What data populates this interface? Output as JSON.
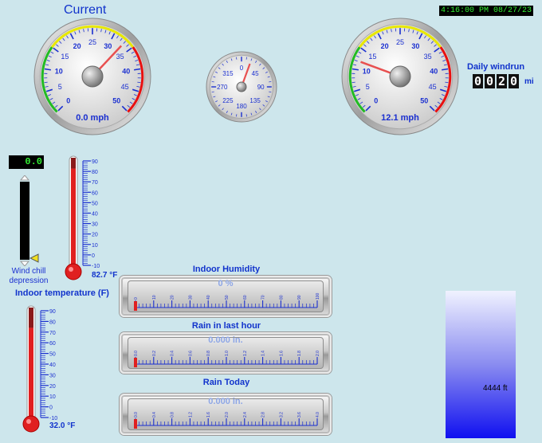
{
  "header": {
    "title": "Current",
    "timestamp": "4:16:00 PM 08/27/23"
  },
  "wind_gauge": {
    "value_label": "0.0 mph",
    "ticks": [
      "0",
      "5",
      "10",
      "15",
      "20",
      "25",
      "30",
      "35",
      "40",
      "45",
      "50"
    ],
    "min": 0,
    "max": 50,
    "needle": 33
  },
  "direction_gauge": {
    "ticks": [
      "315",
      "0",
      "45",
      "90",
      "135",
      "180",
      "225",
      "270"
    ],
    "needle_deg": 20
  },
  "gust_gauge": {
    "value_label": "12.1 mph",
    "ticks": [
      "0",
      "5",
      "10",
      "15",
      "20",
      "25",
      "30",
      "35",
      "40",
      "45",
      "50"
    ],
    "min": 0,
    "max": 50,
    "needle": 12.1
  },
  "windrun": {
    "label": "Daily windrun",
    "digits": [
      "0",
      "0",
      "2",
      "0"
    ],
    "unit": "mi"
  },
  "wind_chill": {
    "display": "0.0",
    "label_line1": "Wind chill",
    "label_line2": "depression",
    "value": 0.0
  },
  "outdoor_thermo": {
    "ticks": [
      "90",
      "80",
      "70",
      "60",
      "50",
      "40",
      "30",
      "20",
      "10",
      "0",
      "-10"
    ],
    "min": -10,
    "max": 90,
    "value": 82.7,
    "label": "82.7 °F"
  },
  "indoor_thermo": {
    "title": "Indoor temperature (F)",
    "ticks": [
      "90",
      "80",
      "70",
      "60",
      "50",
      "40",
      "30",
      "20",
      "10",
      "0",
      "-10"
    ],
    "min": -10,
    "max": 90,
    "value": 74.0,
    "label": "32.0 °F"
  },
  "humidity_bar": {
    "title": "Indoor Humidity",
    "value_label": "0 %",
    "ticks": [
      "0",
      "10",
      "20",
      "30",
      "40",
      "50",
      "60",
      "70",
      "80",
      "90",
      "100"
    ]
  },
  "rain_hour_bar": {
    "title": "Rain in last hour",
    "value_label": "0.000 in.",
    "ticks": [
      "0.0",
      "0.2",
      "0.4",
      "0.6",
      "0.8",
      "1.0",
      "1.2",
      "1.4",
      "1.6",
      "1.8",
      "2.0"
    ]
  },
  "rain_today_bar": {
    "title": "Rain Today",
    "value_label": "0.000 in.",
    "ticks": [
      "0.0",
      "0.4",
      "0.8",
      "1.2",
      "1.6",
      "2.0",
      "2.4",
      "2.8",
      "3.2",
      "3.6",
      "4.0"
    ]
  },
  "cloud_base": {
    "label": "4444 ft"
  },
  "colors": {
    "label_blue": "#1133cc",
    "needle_red": "#e85050",
    "green_arc": "#22bb22",
    "yellow_arc": "#e8e800",
    "red_arc": "#e81010"
  }
}
